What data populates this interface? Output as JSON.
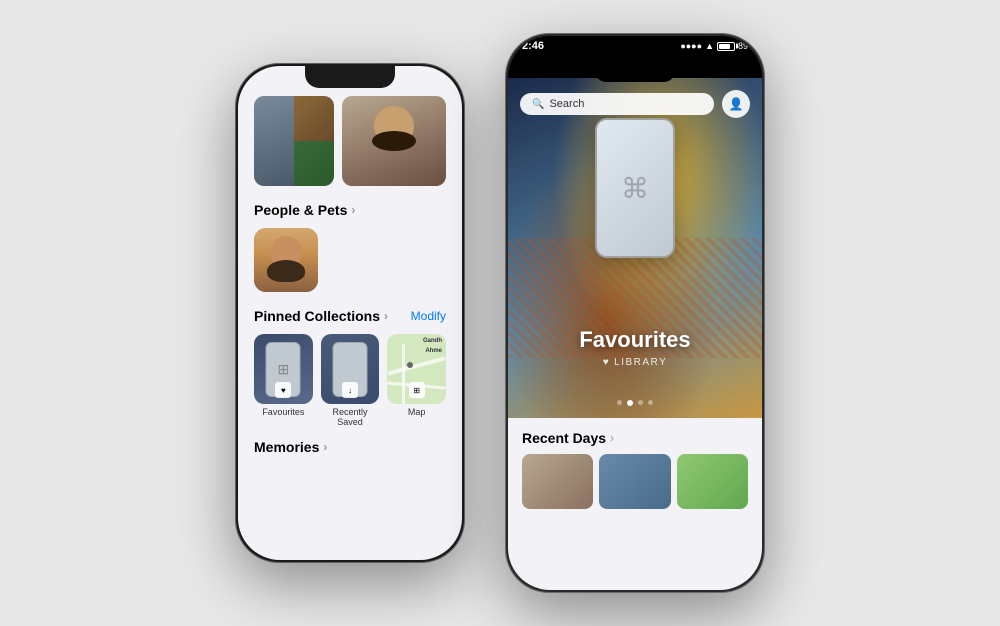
{
  "page": {
    "background": "#e8e8e8"
  },
  "phone1": {
    "sections": {
      "memories": {
        "title": "Memories",
        "chevron": "›"
      },
      "people_pets": {
        "title": "People & Pets",
        "chevron": "›"
      },
      "pinned_collections": {
        "title": "Pinned Collections",
        "chevron": "›",
        "modify": "Modify",
        "items": [
          {
            "label": "Favourites",
            "icon": "♥"
          },
          {
            "label": "Recently Saved",
            "icon": "↓"
          },
          {
            "label": "Map",
            "icon": "⊞"
          }
        ]
      }
    }
  },
  "phone2": {
    "status_bar": {
      "time": "2:46",
      "battery": "89",
      "wifi": "wifi"
    },
    "search": {
      "placeholder": "Search",
      "label": "Search"
    },
    "hero": {
      "title": "Favourites",
      "subtitle": "LIBRARY",
      "heart": "♥"
    },
    "dots": [
      false,
      true,
      false,
      false
    ],
    "recent_days": {
      "title": "Recent Days",
      "chevron": "›"
    }
  }
}
